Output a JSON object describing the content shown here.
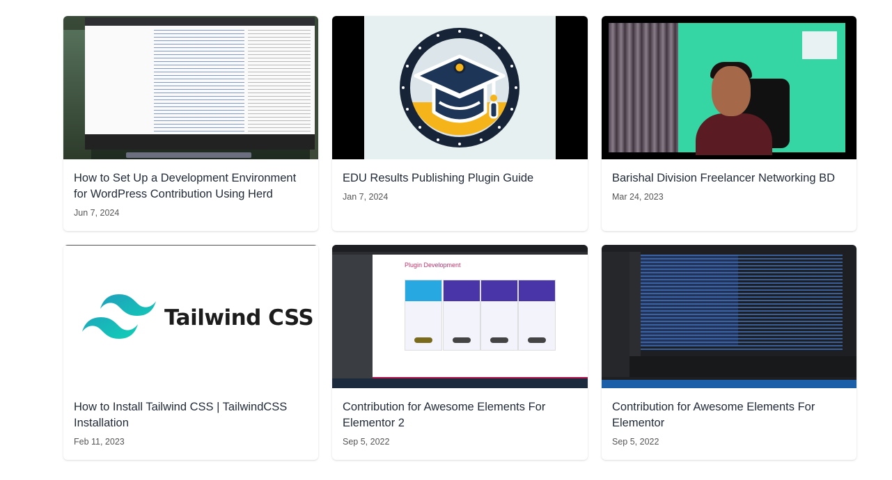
{
  "cards": [
    {
      "title": "How to Set Up a Development Environment for WordPress Contribution Using Herd",
      "date": "Jun 7, 2024",
      "thumbnail_icon": "wordpress-spreadsheet-screenshot"
    },
    {
      "title": "EDU Results Publishing Plugin Guide",
      "date": "Jan 7, 2024",
      "thumbnail_icon": "graduation-cap-logo"
    },
    {
      "title": "Barishal Division Freelancer Networking BD",
      "date": "Mar 24, 2023",
      "thumbnail_icon": "video-call-person"
    },
    {
      "title": "How to Install Tailwind CSS | TailwindCSS Installation",
      "date": "Feb 11, 2023",
      "thumbnail_icon": "tailwind-css-logo",
      "thumbnail_text": "Tailwind CSS"
    },
    {
      "title": "Contribution for Awesome Elements For Elementor 2",
      "date": "Sep 5, 2022",
      "thumbnail_icon": "plugin-development-screenshot",
      "thumbnail_text": "Plugin Development"
    },
    {
      "title": "Contribution for Awesome Elements For Elementor",
      "date": "Sep 5, 2022",
      "thumbnail_icon": "code-editor-screenshot"
    }
  ],
  "colors": {
    "title_text": "#1f2937",
    "date_text": "#555555",
    "tailwind_teal": "#38bdf8",
    "edu_navy": "#1d3557",
    "edu_yellow": "#f4b41a"
  }
}
